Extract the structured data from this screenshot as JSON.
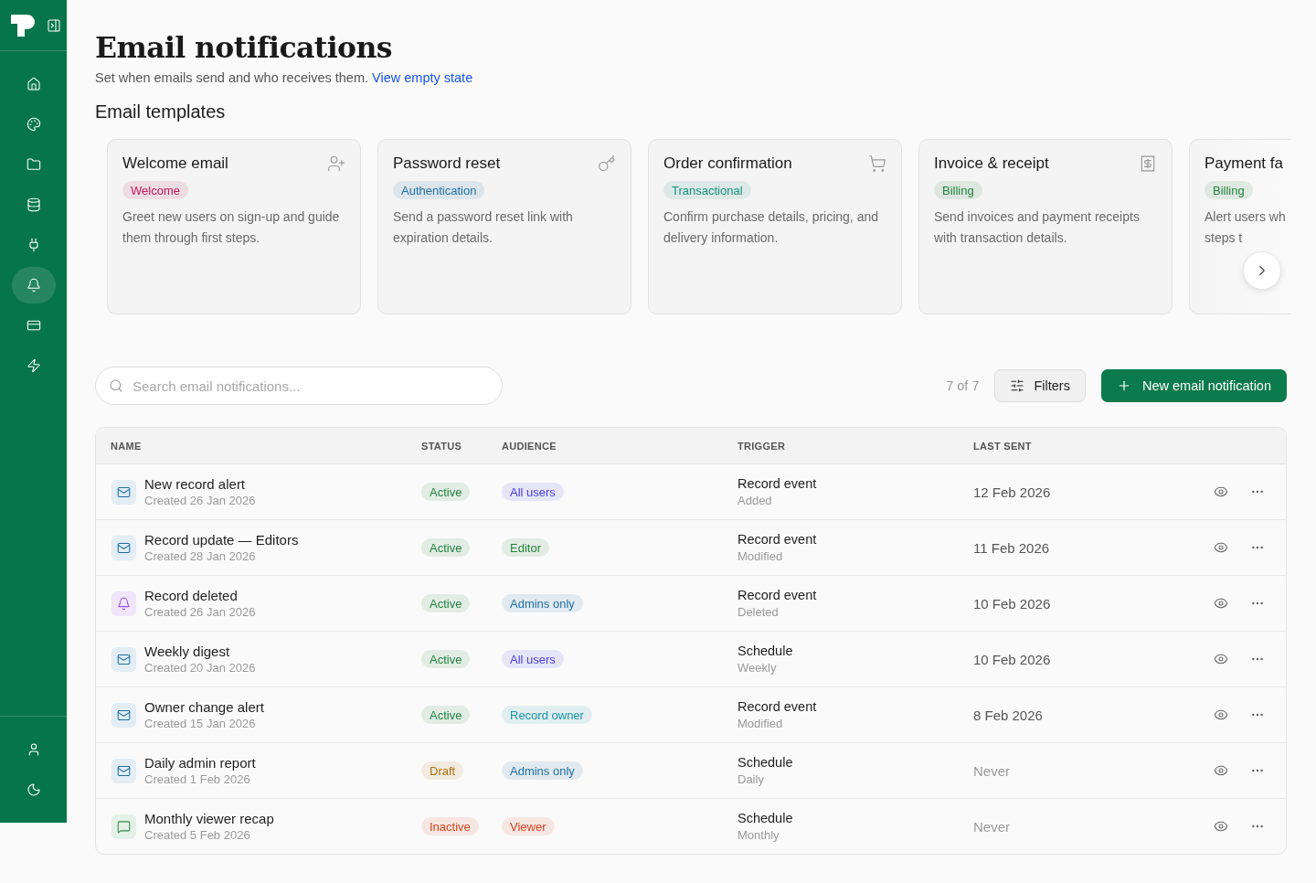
{
  "sidebar": {
    "nav": [
      {
        "selected": false
      },
      {
        "selected": false
      },
      {
        "selected": false
      },
      {
        "selected": false
      },
      {
        "selected": false
      },
      {
        "selected": true
      },
      {
        "selected": false
      },
      {
        "selected": false
      }
    ]
  },
  "header": {
    "title": "Email notifications",
    "subtitle": "Set when emails send and who receives them.",
    "link": "View empty state"
  },
  "templates": {
    "heading": "Email templates",
    "cards": [
      {
        "title": "Welcome email",
        "tag": {
          "label": "Welcome",
          "color": "#c2185b"
        },
        "description": "Greet new users on sign-up and guide them through first steps.",
        "cut_off": false
      },
      {
        "title": "Password reset",
        "tag": {
          "label": "Authentication",
          "color": "#1f6fa3"
        },
        "description": "Send a password reset link with expiration details.",
        "cut_off": false
      },
      {
        "title": "Order confirmation",
        "tag": {
          "label": "Transactional",
          "color": "#17907e"
        },
        "description": "Confirm purchase details, pricing, and delivery information.",
        "cut_off": false
      },
      {
        "title": "Invoice & receipt",
        "tag": {
          "label": "Billing",
          "color": "#23843f"
        },
        "description": "Send invoices and payment receipts with transaction details.",
        "cut_off": false
      },
      {
        "title": "Payment fa",
        "tag": {
          "label": "Billing",
          "color": "#23843f"
        },
        "description": "Alert users wh steps t",
        "cut_off": true
      }
    ]
  },
  "toolbar": {
    "search": {
      "placeholder": "Search email notifications..."
    },
    "count": "7 of 7",
    "filters": "Filters",
    "new_button": "New email notification"
  },
  "table": {
    "columns": [
      "NAME",
      "STATUS",
      "AUDIENCE",
      "TRIGGER",
      "LAST SENT"
    ],
    "rows": [
      {
        "name": "New record alert",
        "created": "Created 26 Jan 2026",
        "status": {
          "label": "Active",
          "color": "#23843f"
        },
        "audience": {
          "label": "All users",
          "color": "#4a3fe0"
        },
        "trigger": {
          "event": "Record event",
          "detail": "Added"
        },
        "last_sent": "12 Feb 2026",
        "sent": true
      },
      {
        "name": "Record update — Editors",
        "created": "Created 28 Jan 2026",
        "status": {
          "label": "Active",
          "color": "#23843f"
        },
        "audience": {
          "label": "Editor",
          "color": "#23843f"
        },
        "trigger": {
          "event": "Record event",
          "detail": "Modified"
        },
        "last_sent": "11 Feb 2026",
        "sent": true
      },
      {
        "name": "Record deleted",
        "created": "Created 26 Jan 2026",
        "status": {
          "label": "Active",
          "color": "#23843f"
        },
        "audience": {
          "label": "Admins only",
          "color": "#1f6fa3"
        },
        "trigger": {
          "event": "Record event",
          "detail": "Deleted"
        },
        "last_sent": "10 Feb 2026",
        "sent": true
      },
      {
        "name": "Weekly digest",
        "created": "Created 20 Jan 2026",
        "status": {
          "label": "Active",
          "color": "#23843f"
        },
        "audience": {
          "label": "All users",
          "color": "#4a3fe0"
        },
        "trigger": {
          "event": "Schedule",
          "detail": "Weekly"
        },
        "last_sent": "10 Feb 2026",
        "sent": true
      },
      {
        "name": "Owner change alert",
        "created": "Created 15 Jan 2026",
        "status": {
          "label": "Active",
          "color": "#23843f"
        },
        "audience": {
          "label": "Record owner",
          "color": "#1a94a8"
        },
        "trigger": {
          "event": "Record event",
          "detail": "Modified"
        },
        "last_sent": "8 Feb 2026",
        "sent": true
      },
      {
        "name": "Daily admin report",
        "created": "Created 1 Feb 2026",
        "status": {
          "label": "Draft",
          "color": "#b06e0c"
        },
        "audience": {
          "label": "Admins only",
          "color": "#1f6fa3"
        },
        "trigger": {
          "event": "Schedule",
          "detail": "Daily"
        },
        "last_sent": "Never",
        "sent": false
      },
      {
        "name": "Monthly viewer recap",
        "created": "Created 5 Feb 2026",
        "status": {
          "label": "Inactive",
          "color": "#d2451e"
        },
        "audience": {
          "label": "Viewer",
          "color": "#d2451e"
        },
        "trigger": {
          "event": "Schedule",
          "detail": "Monthly"
        },
        "last_sent": "Never",
        "sent": false
      }
    ]
  }
}
